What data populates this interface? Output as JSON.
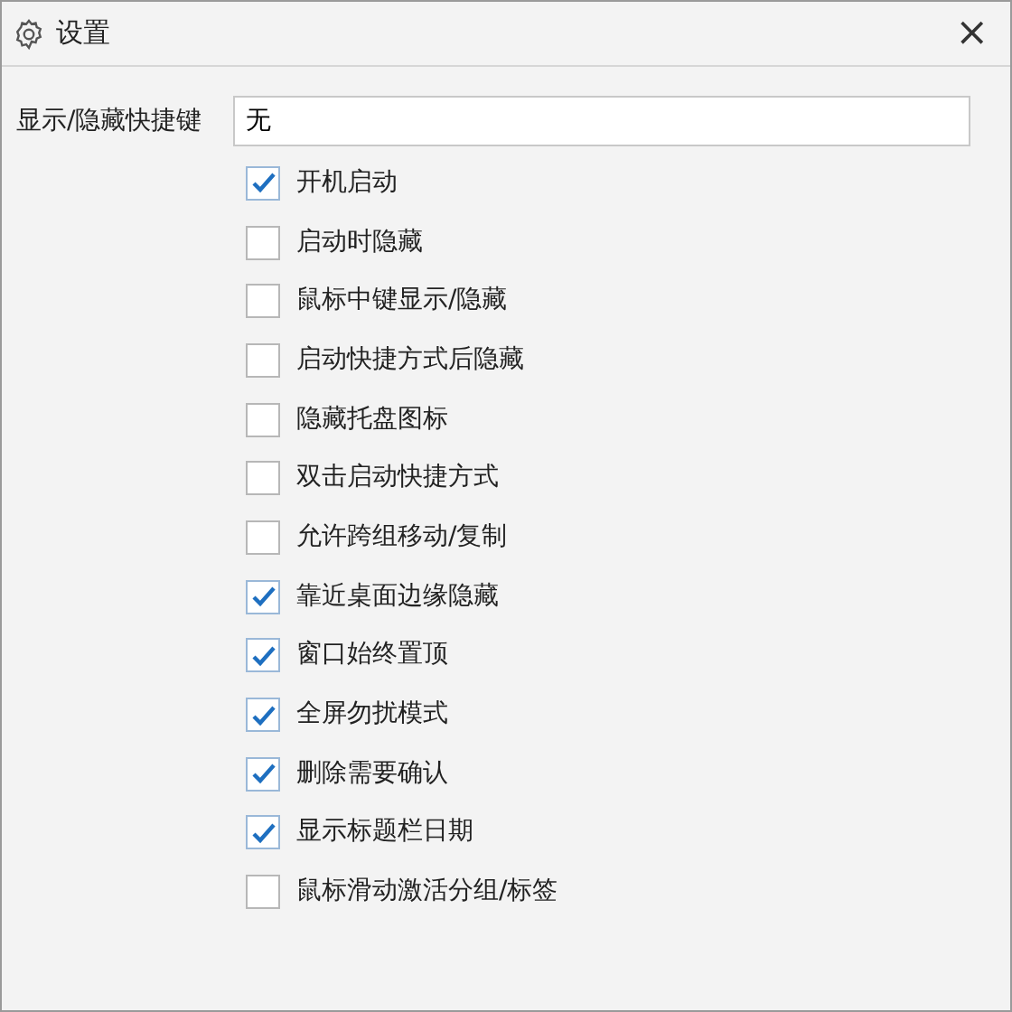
{
  "window": {
    "title": "设置",
    "close": "×"
  },
  "shortcut": {
    "label": "显示/隐藏快捷键",
    "value": "无"
  },
  "options": [
    {
      "label": "开机启动",
      "checked": true
    },
    {
      "label": "启动时隐藏",
      "checked": false
    },
    {
      "label": "鼠标中键显示/隐藏",
      "checked": false
    },
    {
      "label": "启动快捷方式后隐藏",
      "checked": false
    },
    {
      "label": "隐藏托盘图标",
      "checked": false
    },
    {
      "label": "双击启动快捷方式",
      "checked": false
    },
    {
      "label": "允许跨组移动/复制",
      "checked": false
    },
    {
      "label": "靠近桌面边缘隐藏",
      "checked": true
    },
    {
      "label": "窗口始终置顶",
      "checked": true
    },
    {
      "label": "全屏勿扰模式",
      "checked": true
    },
    {
      "label": "删除需要确认",
      "checked": true
    },
    {
      "label": "显示标题栏日期",
      "checked": true
    },
    {
      "label": "鼠标滑动激活分组/标签",
      "checked": false
    }
  ]
}
